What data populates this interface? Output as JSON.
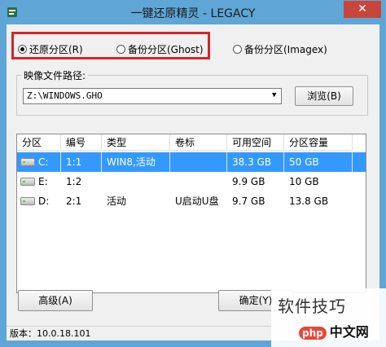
{
  "window": {
    "title": "一键还原精灵 - LEGACY",
    "close_glyph": "✕"
  },
  "mode": {
    "options": [
      {
        "label": "还原分区(R)",
        "selected": true
      },
      {
        "label": "备份分区(Ghost)",
        "selected": false
      },
      {
        "label": "备份分区(Imagex)",
        "selected": false
      }
    ]
  },
  "image": {
    "group_label": "映像文件路径:",
    "path": "Z:\\WINDOWS.GHO",
    "browse_label": "浏览(B)"
  },
  "table": {
    "headers": [
      "分区",
      "编号",
      "类型",
      "卷标",
      "可用空间",
      "分区容量"
    ],
    "rows": [
      {
        "drive": "C:",
        "num": "1:1",
        "type": "WIN8,活动",
        "label": "",
        "free": "38.3 GB",
        "size": "50 GB",
        "selected": true
      },
      {
        "drive": "E:",
        "num": "1:2",
        "type": "",
        "label": "",
        "free": "9.9 GB",
        "size": "10 GB",
        "selected": false
      },
      {
        "drive": "D:",
        "num": "2:1",
        "type": "活动",
        "label": "U启动U盘",
        "free": "9.7 GB",
        "size": "13.8 GB",
        "selected": false
      }
    ]
  },
  "buttons": {
    "advanced": "高级(A)",
    "ok": "确定(Y)"
  },
  "status": {
    "version": "版本：10.0.18.101"
  },
  "watermark": {
    "text": "软件技巧",
    "logo_badge": "php",
    "logo_text": "中文网"
  },
  "colors": {
    "titlebar": "#5fa6d6",
    "close": "#c7463b",
    "selection": "#3399ff",
    "highlight": "#d6242a"
  }
}
